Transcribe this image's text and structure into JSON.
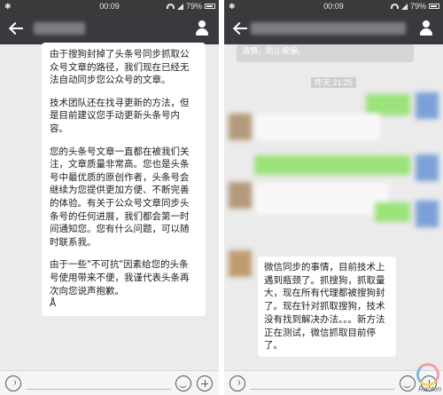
{
  "left_phone": {
    "status": {
      "time": "00:09",
      "battery": "79%"
    },
    "message_paragraphs": [
      "由于搜狗封掉了头条号同步抓取公众号文章的路径，我们现在已经无法自动同步您公众号的文章。",
      "技术团队还在找寻更新的方法，但是目前建议您手动更新头条号内容。",
      "您的头条号文章一直都在被我们关注，文章质量非常高。您也是头条号中最优质的原创作者，头条号会继续为您提供更加方便、不断完善的体验。有关于公众号文章同步头条号的任何进展，我们都会第一时间通知您。您有什么问题，可以随时联系我。",
      "由于一些\"不可抗\"因素给您的头条号使用带来不便，我谨代表头条再次向您说声抱歉。",
      "Å"
    ]
  },
  "right_phone": {
    "status": {
      "time": "00:09",
      "battery": "79%"
    },
    "system_message": "请慎，防止被骗。",
    "timestamp": "昨天 21:25",
    "reply_message": "微信同步的事情，目前技术上遇到瓶颈了。抓搜狗，抓取量大，现在所有代理都被搜狗封了。现在针对抓取搜狗，技术没有找到解决办法。。。新方法正在测试，微信抓取目前停了。"
  },
  "watermark": {
    "text": "Raoten"
  },
  "icons": {
    "back": "back-arrow-icon",
    "profile": "person-icon",
    "voice": "voice-icon",
    "emoji": "emoji-icon",
    "more": "plus-icon"
  }
}
